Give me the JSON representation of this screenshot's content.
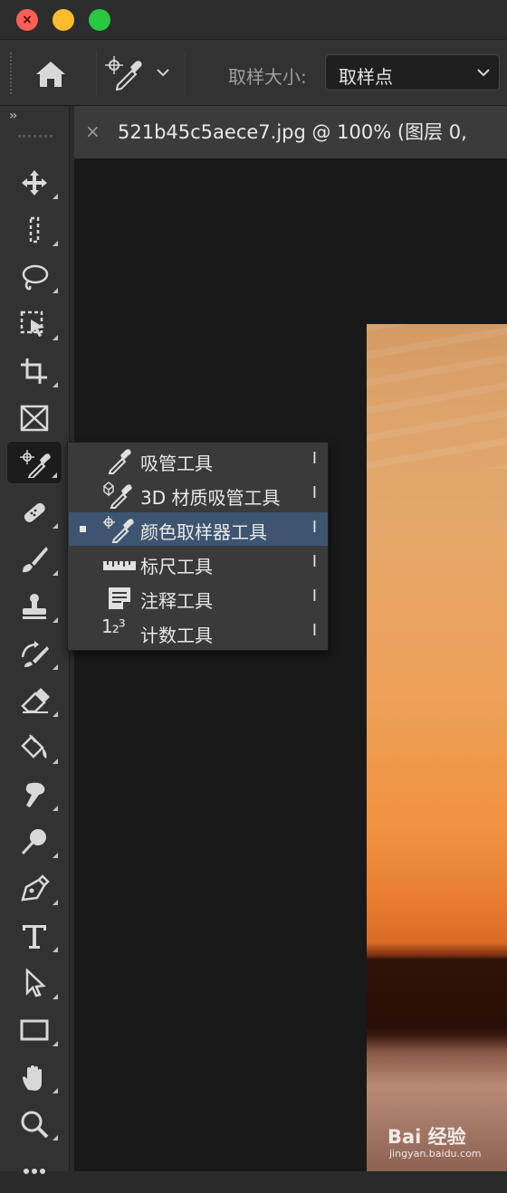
{
  "window": {
    "traffic_lights": [
      {
        "name": "close",
        "color": "#ff5f57",
        "glyph": "×"
      },
      {
        "name": "minimize",
        "color": "#febc2e",
        "glyph": ""
      },
      {
        "name": "zoom",
        "color": "#28c840",
        "glyph": ""
      }
    ]
  },
  "options_bar": {
    "home_icon": "home-icon",
    "tool_preset_icon": "color-sampler-icon",
    "sample_size_label": "取样大小:",
    "sample_size_value": "取样点"
  },
  "toolbar": {
    "collapse_glyph": "››",
    "tools": [
      {
        "icon": "move-icon"
      },
      {
        "icon": "marquee-icon"
      },
      {
        "icon": "lasso-icon"
      },
      {
        "icon": "object-select-icon"
      },
      {
        "icon": "crop-icon"
      },
      {
        "icon": "frame-icon"
      },
      {
        "icon": "color-sampler-icon",
        "active": true
      },
      {
        "icon": "healing-brush-icon"
      },
      {
        "icon": "brush-icon"
      },
      {
        "icon": "stamp-icon"
      },
      {
        "icon": "history-brush-icon"
      },
      {
        "icon": "eraser-icon"
      },
      {
        "icon": "paint-bucket-icon"
      },
      {
        "icon": "smudge-icon"
      },
      {
        "icon": "dodge-icon"
      },
      {
        "icon": "pen-icon"
      },
      {
        "icon": "type-icon"
      },
      {
        "icon": "path-select-icon"
      },
      {
        "icon": "rectangle-icon"
      },
      {
        "icon": "hand-icon"
      },
      {
        "icon": "zoom-icon"
      },
      {
        "icon": "more-icon"
      }
    ]
  },
  "document_tab": {
    "close_glyph": "×",
    "title": "521b45c5aece7.jpg @ 100% (图层 0,"
  },
  "flyout_menu": {
    "items": [
      {
        "label": "吸管工具",
        "shortcut": "I",
        "icon": "eyedropper-icon",
        "selected": false
      },
      {
        "label": "3D 材质吸管工具",
        "shortcut": "I",
        "icon": "3d-material-eyedropper-icon",
        "selected": false
      },
      {
        "label": "颜色取样器工具",
        "shortcut": "I",
        "icon": "color-sampler-icon",
        "selected": true
      },
      {
        "label": "标尺工具",
        "shortcut": "I",
        "icon": "ruler-icon",
        "selected": false
      },
      {
        "label": "注释工具",
        "shortcut": "I",
        "icon": "note-icon",
        "selected": false
      },
      {
        "label": "计数工具",
        "shortcut": "I",
        "icon": "count-icon",
        "selected": false,
        "glyph": "1₂³"
      }
    ]
  },
  "watermark": {
    "logo": "Bai 经验",
    "url": "jingyan.baidu.com"
  },
  "colors": {
    "selection": "#3e5572",
    "panel": "#323232",
    "canvas": "#191919"
  }
}
